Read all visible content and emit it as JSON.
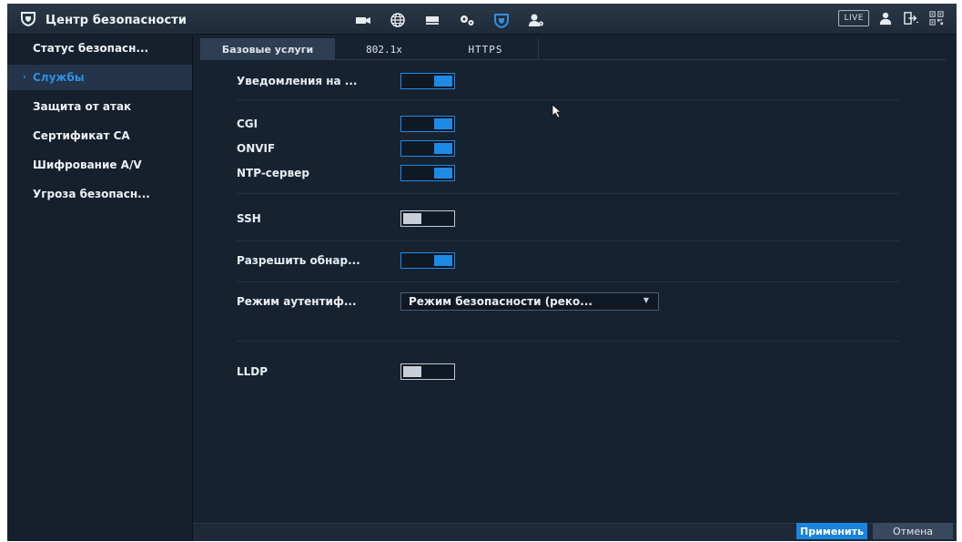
{
  "header": {
    "title": "Центр безопасности",
    "nav_icons": [
      "camera-icon",
      "globe-icon",
      "storage-icon",
      "settings-icon",
      "security-shield-icon",
      "account-icon"
    ],
    "live_label": "LIVE",
    "right_icons": [
      "user-icon",
      "logout-icon",
      "qr-code-icon"
    ]
  },
  "sidebar": {
    "items": [
      {
        "label": "Статус безопасн..."
      },
      {
        "label": "Службы",
        "active": true
      },
      {
        "label": "Защита от атак"
      },
      {
        "label": "Сертификат CA"
      },
      {
        "label": "Шифрование A/V"
      },
      {
        "label": "Угроза безопасн..."
      }
    ]
  },
  "tabs": [
    {
      "label": "Базовые услуги",
      "active": true
    },
    {
      "label": "802.1x"
    },
    {
      "label": "HTTPS"
    }
  ],
  "settings": {
    "notifications": {
      "label": "Уведомления на ...",
      "on": true
    },
    "cgi": {
      "label": "CGI",
      "on": true
    },
    "onvif": {
      "label": "ONVIF",
      "on": true
    },
    "ntp": {
      "label": "NTP-сервер",
      "on": true
    },
    "ssh": {
      "label": "SSH",
      "on": false
    },
    "discovery": {
      "label": "Разрешить обнар...",
      "on": true
    },
    "auth_mode": {
      "label": "Режим аутентиф...",
      "value": "Режим безопасности (реко..."
    },
    "lldp": {
      "label": "LLDP",
      "on": false
    }
  },
  "footer": {
    "apply_label": "Применить",
    "cancel_label": "Отмена"
  },
  "colors": {
    "accent": "#1f8ae6",
    "background": "#172231",
    "sidebar_active_text": "#2f8fe0"
  }
}
